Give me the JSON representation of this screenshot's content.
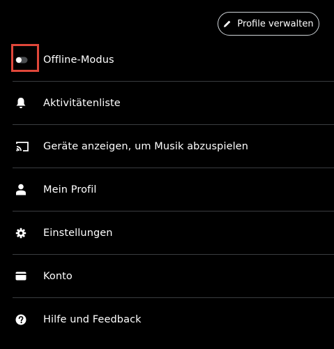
{
  "header": {
    "manage_profiles_label": "Profile verwalten",
    "manage_profiles_icon": "pencil-icon"
  },
  "menu": {
    "items": [
      {
        "label": "Offline-Modus",
        "icon": "toggle-switch-icon",
        "toggle_on": false,
        "highlighted": true
      },
      {
        "label": "Aktivitätenliste",
        "icon": "bell-icon"
      },
      {
        "label": "Geräte anzeigen, um Musik abzuspielen",
        "icon": "cast-icon"
      },
      {
        "label": "Mein Profil",
        "icon": "person-icon"
      },
      {
        "label": "Einstellungen",
        "icon": "gear-icon"
      },
      {
        "label": "Konto",
        "icon": "wallet-icon"
      },
      {
        "label": "Hilfe und Feedback",
        "icon": "help-circle-icon"
      }
    ]
  },
  "colors": {
    "background": "#000000",
    "text": "#ffffff",
    "divider": "#3a3d40",
    "highlight": "#e0473a",
    "button_border": "#cfd4d8"
  }
}
